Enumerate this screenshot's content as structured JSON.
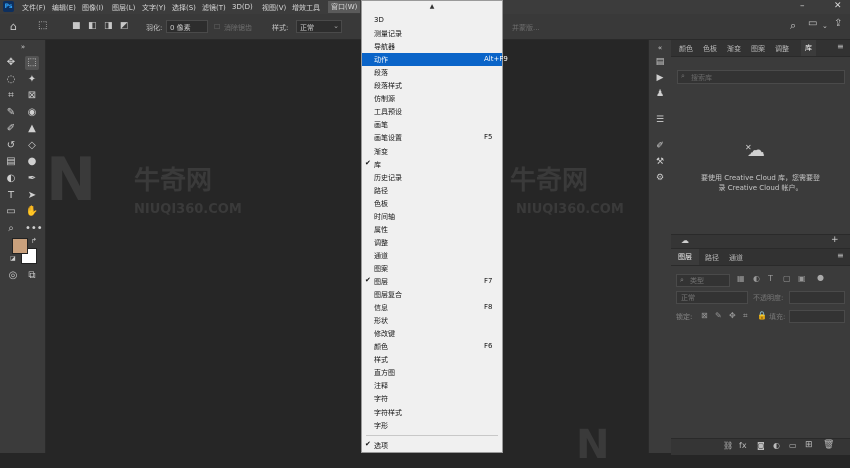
{
  "menubar": {
    "logo": "Ps",
    "items": [
      "文件(F)",
      "编辑(E)",
      "图像(I)",
      "图层(L)",
      "文字(Y)",
      "选择(S)",
      "滤镜(T)",
      "3D(D)",
      "视图(V)",
      "增效工具",
      "窗口(W)"
    ]
  },
  "options": {
    "feather_label": "羽化:",
    "feather_value": "0 像素",
    "antialias_label": "消除锯齿",
    "style_label": "样式:",
    "style_value": "正常",
    "right_hint": "并蒙版..."
  },
  "watermark": {
    "brand": "牛奇网",
    "url": "NIUQI360.COM"
  },
  "panel_top": {
    "tabs": [
      "颜色",
      "色板",
      "渐变",
      "图案",
      "调整",
      "库"
    ],
    "search_placeholder": "搜索库",
    "message_line1": "要使用 Creative Cloud 库，您需要登",
    "message_line2": "录 Creative Cloud 帐户。"
  },
  "panel_layers": {
    "tabs": [
      "图层",
      "路径",
      "通道"
    ],
    "kind_label": "类型",
    "blend_mode": "正常",
    "opacity_label": "不透明度:",
    "lock_label": "锁定:",
    "fill_label": "填充:"
  },
  "window_menu": {
    "top_arrow": "▲",
    "items": [
      {
        "label": "3D",
        "shortcut": "",
        "checked": false
      },
      {
        "label": "测量记录",
        "shortcut": "",
        "checked": false
      },
      {
        "label": "导航器",
        "shortcut": "",
        "checked": false
      },
      {
        "label": "动作",
        "shortcut": "Alt+F9",
        "checked": false,
        "highlighted": true
      },
      {
        "label": "段落",
        "shortcut": "",
        "checked": false
      },
      {
        "label": "段落样式",
        "shortcut": "",
        "checked": false
      },
      {
        "label": "仿制源",
        "shortcut": "",
        "checked": false
      },
      {
        "label": "工具预设",
        "shortcut": "",
        "checked": false
      },
      {
        "label": "画笔",
        "shortcut": "",
        "checked": false
      },
      {
        "label": "画笔设置",
        "shortcut": "F5",
        "checked": false
      },
      {
        "label": "渐变",
        "shortcut": "",
        "checked": false
      },
      {
        "label": "库",
        "shortcut": "",
        "checked": true
      },
      {
        "label": "历史记录",
        "shortcut": "",
        "checked": false
      },
      {
        "label": "路径",
        "shortcut": "",
        "checked": false
      },
      {
        "label": "色板",
        "shortcut": "",
        "checked": false
      },
      {
        "label": "时间轴",
        "shortcut": "",
        "checked": false
      },
      {
        "label": "属性",
        "shortcut": "",
        "checked": false
      },
      {
        "label": "调整",
        "shortcut": "",
        "checked": false
      },
      {
        "label": "通道",
        "shortcut": "",
        "checked": false
      },
      {
        "label": "图案",
        "shortcut": "",
        "checked": false
      },
      {
        "label": "图层",
        "shortcut": "F7",
        "checked": true
      },
      {
        "label": "图层复合",
        "shortcut": "",
        "checked": false
      },
      {
        "label": "信息",
        "shortcut": "F8",
        "checked": false
      },
      {
        "label": "形状",
        "shortcut": "",
        "checked": false
      },
      {
        "label": "修改键",
        "shortcut": "",
        "checked": false
      },
      {
        "label": "颜色",
        "shortcut": "F6",
        "checked": false
      },
      {
        "label": "样式",
        "shortcut": "",
        "checked": false
      },
      {
        "label": "直方图",
        "shortcut": "",
        "checked": false
      },
      {
        "label": "注释",
        "shortcut": "",
        "checked": false
      },
      {
        "label": "字符",
        "shortcut": "",
        "checked": false
      },
      {
        "label": "字符样式",
        "shortcut": "",
        "checked": false
      },
      {
        "label": "字形",
        "shortcut": "",
        "checked": false
      }
    ],
    "bottom_item": {
      "label": "选项",
      "checked": true
    },
    "check_glyph": "✔"
  },
  "colors": {
    "foreground": "#c9a07c",
    "background": "#ffffff",
    "menu_highlight": "#0a64c8"
  }
}
